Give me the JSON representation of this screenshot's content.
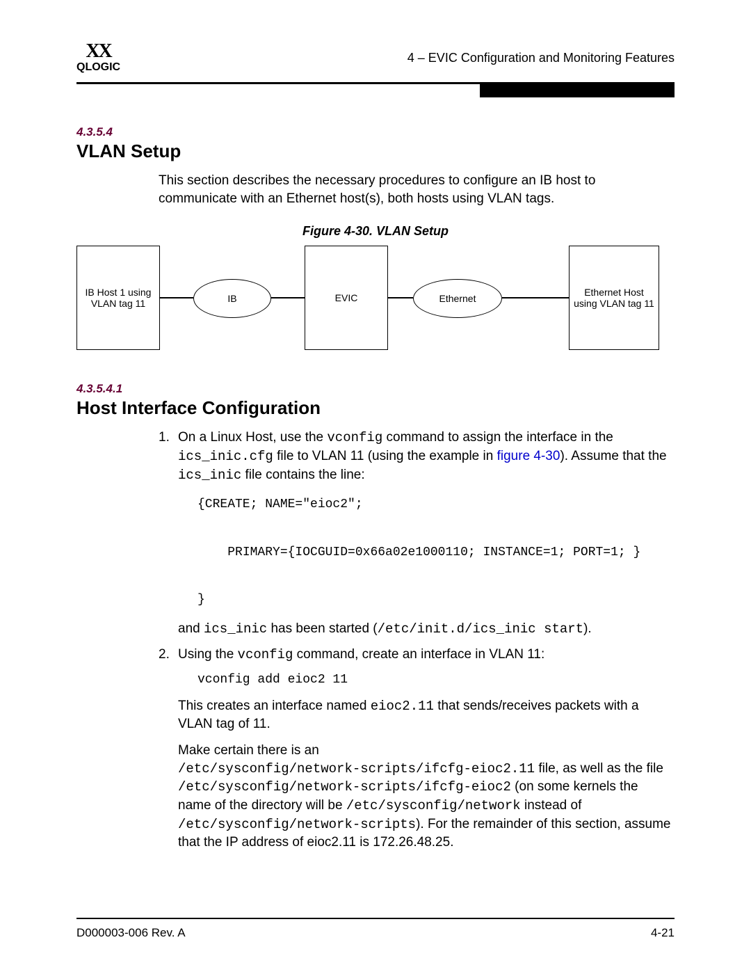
{
  "header": {
    "logo_glyph": "XX",
    "logo_text": "QLOGIC",
    "chapter": "4 – EVIC Configuration and Monitoring Features"
  },
  "section": {
    "num": "4.3.5.4",
    "title": "VLAN Setup",
    "intro": "This section describes the necessary procedures to configure an IB host to communicate with an Ethernet host(s), both hosts using VLAN tags."
  },
  "figure": {
    "caption": "Figure 4-30. VLAN Setup",
    "box_left": "IB Host 1 using VLAN tag 11",
    "ell_ib": "IB",
    "box_evic": "EVIC",
    "ell_eth": "Ethernet",
    "box_right": "Ethernet Host using VLAN tag 11"
  },
  "subsection": {
    "num": "4.3.5.4.1",
    "title": "Host Interface Configuration"
  },
  "steps": {
    "s1": {
      "num": "1.",
      "t1": "On a Linux Host, use the ",
      "c1": "vconfig",
      "t2": " command to assign the interface in the ",
      "c2": "ics_inic.cfg",
      "t3": " file to VLAN 11 (using the example in ",
      "link": "figure 4-30",
      "t4": "). Assume that the ",
      "c3": "ics_inic",
      "t5": " file contains the line:",
      "code": "{CREATE; NAME=\"eioc2\";\n\n    PRIMARY={IOCGUID=0x66a02e1000110; INSTANCE=1; PORT=1; }\n\n}",
      "after1": "and ",
      "after_c1": "ics_inic",
      "after2": " has been started (",
      "after_c2": "/etc/init.d/ics_inic start",
      "after3": ")."
    },
    "s2": {
      "num": "2.",
      "t1": "Using the ",
      "c1": "vconfig",
      "t2": " command, create an interface in VLAN 11:",
      "code": "vconfig add eioc2 11",
      "p2a": "This creates an interface named ",
      "p2code": "eioc2.11",
      "p2b": " that sends/receives packets with a VLAN tag of 11.",
      "p3a": "Make certain there is an ",
      "p3code1": "/etc/sysconfig/network-scripts/ifcfg-eioc2.11",
      "p3b": " file, as well as the file ",
      "p3code2": "/etc/sysconfig/network-scripts/ifcfg-eioc2",
      "p3c": " (on some kernels the name of the directory will be ",
      "p3code3": "/etc/sysconfig/network",
      "p3d": " instead of ",
      "p3code4": "/etc/sysconfig/network-scripts",
      "p3e": "). For the remainder of this section, assume that the IP address of eioc2.11 is 172.26.48.25."
    }
  },
  "footer": {
    "left": "D000003-006 Rev. A",
    "right": "4-21"
  }
}
